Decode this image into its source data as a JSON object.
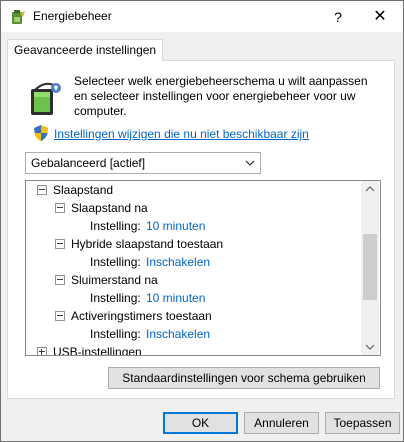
{
  "window": {
    "title": "Energiebeheer",
    "help": "?",
    "close": "✕"
  },
  "tab": {
    "label": "Geavanceerde instellingen"
  },
  "description": "Selecteer welk energiebeheerschema u wilt aanpassen en selecteer instellingen voor energiebeheer voor uw computer.",
  "change_link": "Instellingen wijzigen die nu niet beschikbaar zijn",
  "scheme_select": {
    "value": "Gebalanceerd [actief]"
  },
  "tree": {
    "sleep": "Slaapstand",
    "sleep_after": {
      "label": "Slaapstand na",
      "setting": "Instelling:",
      "value": "10 minuten"
    },
    "hybrid": {
      "label": "Hybride slaapstand toestaan",
      "setting": "Instelling:",
      "value": "Inschakelen"
    },
    "hibernate": {
      "label": "Sluimerstand na",
      "setting": "Instelling:",
      "value": "10 minuten"
    },
    "timers": {
      "label": "Activeringstimers toestaan",
      "setting": "Instelling:",
      "value": "Inschakelen"
    },
    "usb": "USB-instellingen"
  },
  "buttons": {
    "restore_defaults": "Standaardinstellingen voor schema gebruiken",
    "ok": "OK",
    "cancel": "Annuleren",
    "apply": "Toepassen"
  },
  "colors": {
    "link": "#0066cc",
    "accent": "#0078d7"
  }
}
